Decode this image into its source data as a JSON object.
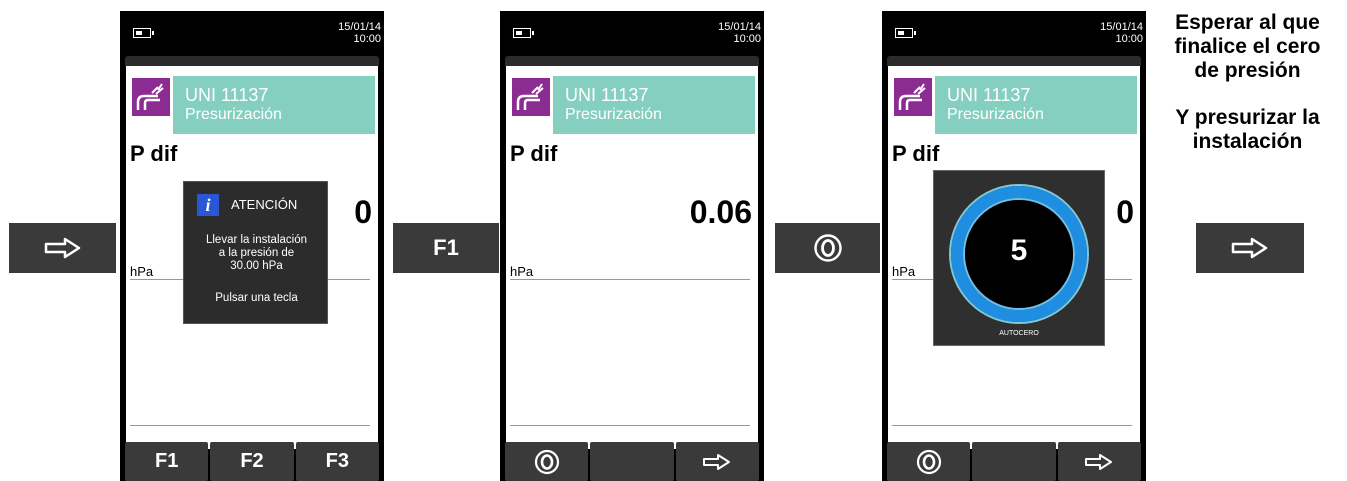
{
  "step_buttons": {
    "b1": {
      "icon": "arrow-right-icon"
    },
    "b2": {
      "label": "F1"
    },
    "b3": {
      "icon": "circle-o-icon"
    },
    "b4": {
      "icon": "arrow-right-icon"
    }
  },
  "phones": [
    {
      "date": "15/01/14",
      "time": "10:00",
      "title_line1": "UNI 11137",
      "title_line2": "Presurización",
      "measure_label": "P dif",
      "value": "0",
      "unit": "hPa",
      "softkeys": [
        "F1",
        "F2",
        "F3"
      ],
      "dialog": {
        "title": "ATENCIÓN",
        "line1": "Llevar la instalación",
        "line2": "a la presión de",
        "line3": "30.00 hPa",
        "line4": "Pulsar una tecla"
      }
    },
    {
      "date": "15/01/14",
      "time": "10:00",
      "title_line1": "UNI 11137",
      "title_line2": "Presurización",
      "measure_label": "P dif",
      "value": "0.06",
      "unit": "hPa",
      "softkeys": [
        "circle-o-icon",
        "",
        "arrow-right-icon"
      ]
    },
    {
      "date": "15/01/14",
      "time": "10:00",
      "title_line1": "UNI 11137",
      "title_line2": "Presurización",
      "measure_label": "P dif",
      "value": "0",
      "unit": "hPa",
      "softkeys": [
        "circle-o-icon",
        "",
        "arrow-right-icon"
      ],
      "autozero": {
        "countdown": "5",
        "label": "AUTOCERO"
      }
    }
  ],
  "instructions": {
    "line1": "Esperar al que",
    "line2": "finalice el cero",
    "line3": "de presión",
    "line4": "Y presurizar la",
    "line5": "instalación"
  },
  "colors": {
    "title_bar": "#85cfc0",
    "title_icon": "#8a2c92",
    "button_dark": "#3a3a3a",
    "info_blue": "#2a57d6",
    "ring_blue": "#1f8ee0"
  }
}
